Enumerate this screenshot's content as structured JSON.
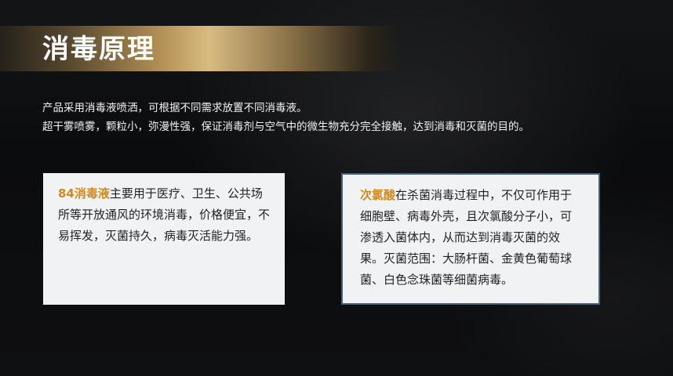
{
  "title": "消毒原理",
  "intro": {
    "line1": "产品采用消毒液喷洒，可根据不同需求放置不同消毒液。",
    "line2": "超干雾喷雾，颗粒小，弥漫性强，保证消毒剂与空气中的微生物充分完全接触，达到消毒和灭菌的目的。"
  },
  "cards": [
    {
      "highlight": "84消毒液",
      "body": "主要用于医疗、卫生、公共场所等开放通风的环境消毒，价格便宜，不易挥发，灭菌持久，病毒灭活能力强。"
    },
    {
      "highlight": "次氯酸",
      "body": "在杀菌消毒过程中，不仅可作用于细胞壁、病毒外壳，且次氯酸分子小，可渗透入菌体内，从而达到消毒灭菌的效果。灭菌范围：大肠杆菌、金黄色葡萄球菌、白色念珠菌等细菌病毒。"
    }
  ],
  "colors": {
    "accent": "#d18a1c",
    "card_bg": "#f1f2f4",
    "card_border": "#4a6282",
    "background": "#0b0c0e"
  }
}
